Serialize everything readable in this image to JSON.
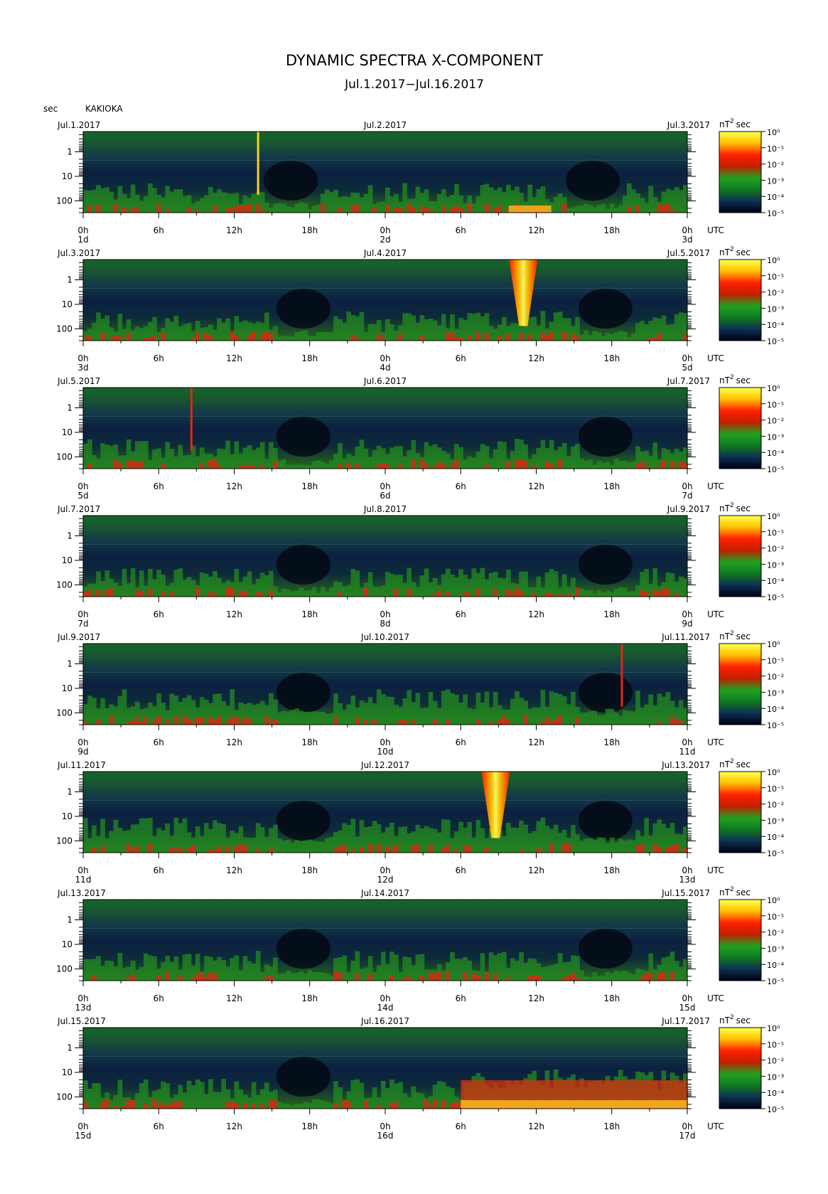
{
  "chart_data": {
    "type": "heatmap",
    "title": "DYNAMIC SPECTRA X-COMPONENT",
    "subtitle": "Jul.1.2017−Jul.16.2017",
    "station": "KAKIOKA",
    "y_unit": "sec",
    "y_scale": "log",
    "ylim": [
      300,
      0.15
    ],
    "y_ticks": [
      "1",
      "10",
      "100"
    ],
    "x_tick_labels": [
      "0h",
      "6h",
      "12h",
      "18h",
      "0h",
      "6h",
      "12h",
      "18h",
      "0h"
    ],
    "x_unit": "UTC",
    "colorbar": {
      "unit_label": "nT",
      "unit_sup": "2",
      "unit_suffix": "sec",
      "scale": "log",
      "tick_labels": [
        "10⁰",
        "10⁻¹",
        "10⁻²",
        "10⁻³",
        "10⁻⁴",
        "10⁻⁵"
      ],
      "colors": [
        "#ffff50",
        "#ffc000",
        "#ff2000",
        "#c02000",
        "#20a020",
        "#107a20",
        "#0e3050",
        "#000010"
      ]
    },
    "panels": [
      {
        "date_left": "Jul.1.2017",
        "date_mid": "Jul.2.2017",
        "date_right": "Jul.3.2017",
        "day_left": "1d",
        "day_mid": "2d",
        "day_right": "3d",
        "events": [
          {
            "hour": 13.9,
            "type": "spike",
            "intensity": "yellow"
          },
          {
            "hour": 16.5,
            "type": "quiet"
          },
          {
            "hour": 40.5,
            "type": "quiet"
          },
          {
            "hour": 35.5,
            "type": "band",
            "intensity": "yellow"
          }
        ]
      },
      {
        "date_left": "Jul.3.2017",
        "date_mid": "Jul.4.2017",
        "date_right": "Jul.5.2017",
        "day_left": "3d",
        "day_mid": "4d",
        "day_right": "5d",
        "events": [
          {
            "hour": 35.2,
            "type": "burst",
            "intensity": "yellow"
          },
          {
            "hour": 17.5,
            "type": "quiet"
          },
          {
            "hour": 41.5,
            "type": "quiet"
          }
        ]
      },
      {
        "date_left": "Jul.5.2017",
        "date_mid": "Jul.6.2017",
        "date_right": "Jul.7.2017",
        "day_left": "5d",
        "day_mid": "6d",
        "day_right": "7d",
        "events": [
          {
            "hour": 8.6,
            "type": "spike",
            "intensity": "red"
          },
          {
            "hour": 17.5,
            "type": "quiet"
          },
          {
            "hour": 41.5,
            "type": "quiet"
          }
        ]
      },
      {
        "date_left": "Jul.7.2017",
        "date_mid": "Jul.8.2017",
        "date_right": "Jul.9.2017",
        "day_left": "7d",
        "day_mid": "8d",
        "day_right": "9d",
        "events": [
          {
            "hour": 17.5,
            "type": "quiet"
          },
          {
            "hour": 41.5,
            "type": "quiet"
          }
        ]
      },
      {
        "date_left": "Jul.9.2017",
        "date_mid": "Jul.10.2017",
        "date_right": "Jul.11.2017",
        "day_left": "9d",
        "day_mid": "10d",
        "day_right": "11d",
        "events": [
          {
            "hour": 42.8,
            "type": "spike",
            "intensity": "red"
          },
          {
            "hour": 17.5,
            "type": "quiet"
          },
          {
            "hour": 41.5,
            "type": "quiet"
          }
        ]
      },
      {
        "date_left": "Jul.11.2017",
        "date_mid": "Jul.12.2017",
        "date_right": "Jul.13.2017",
        "day_left": "11d",
        "day_mid": "12d",
        "day_right": "13d",
        "events": [
          {
            "hour": 33.0,
            "type": "burst",
            "intensity": "yellow"
          },
          {
            "hour": 17.5,
            "type": "quiet"
          },
          {
            "hour": 41.5,
            "type": "quiet"
          }
        ]
      },
      {
        "date_left": "Jul.13.2017",
        "date_mid": "Jul.14.2017",
        "date_right": "Jul.15.2017",
        "day_left": "13d",
        "day_mid": "14d",
        "day_right": "15d",
        "events": [
          {
            "hour": 17.5,
            "type": "quiet"
          },
          {
            "hour": 41.5,
            "type": "quiet"
          }
        ]
      },
      {
        "date_left": "Jul.15.2017",
        "date_mid": "Jul.16.2017",
        "date_right": "Jul.17.2017",
        "day_left": "15d",
        "day_mid": "16d",
        "day_right": "17d",
        "events": [
          {
            "hour": 30.0,
            "type": "storm",
            "intensity": "yellow"
          },
          {
            "hour": 17.5,
            "type": "quiet"
          }
        ]
      }
    ]
  }
}
